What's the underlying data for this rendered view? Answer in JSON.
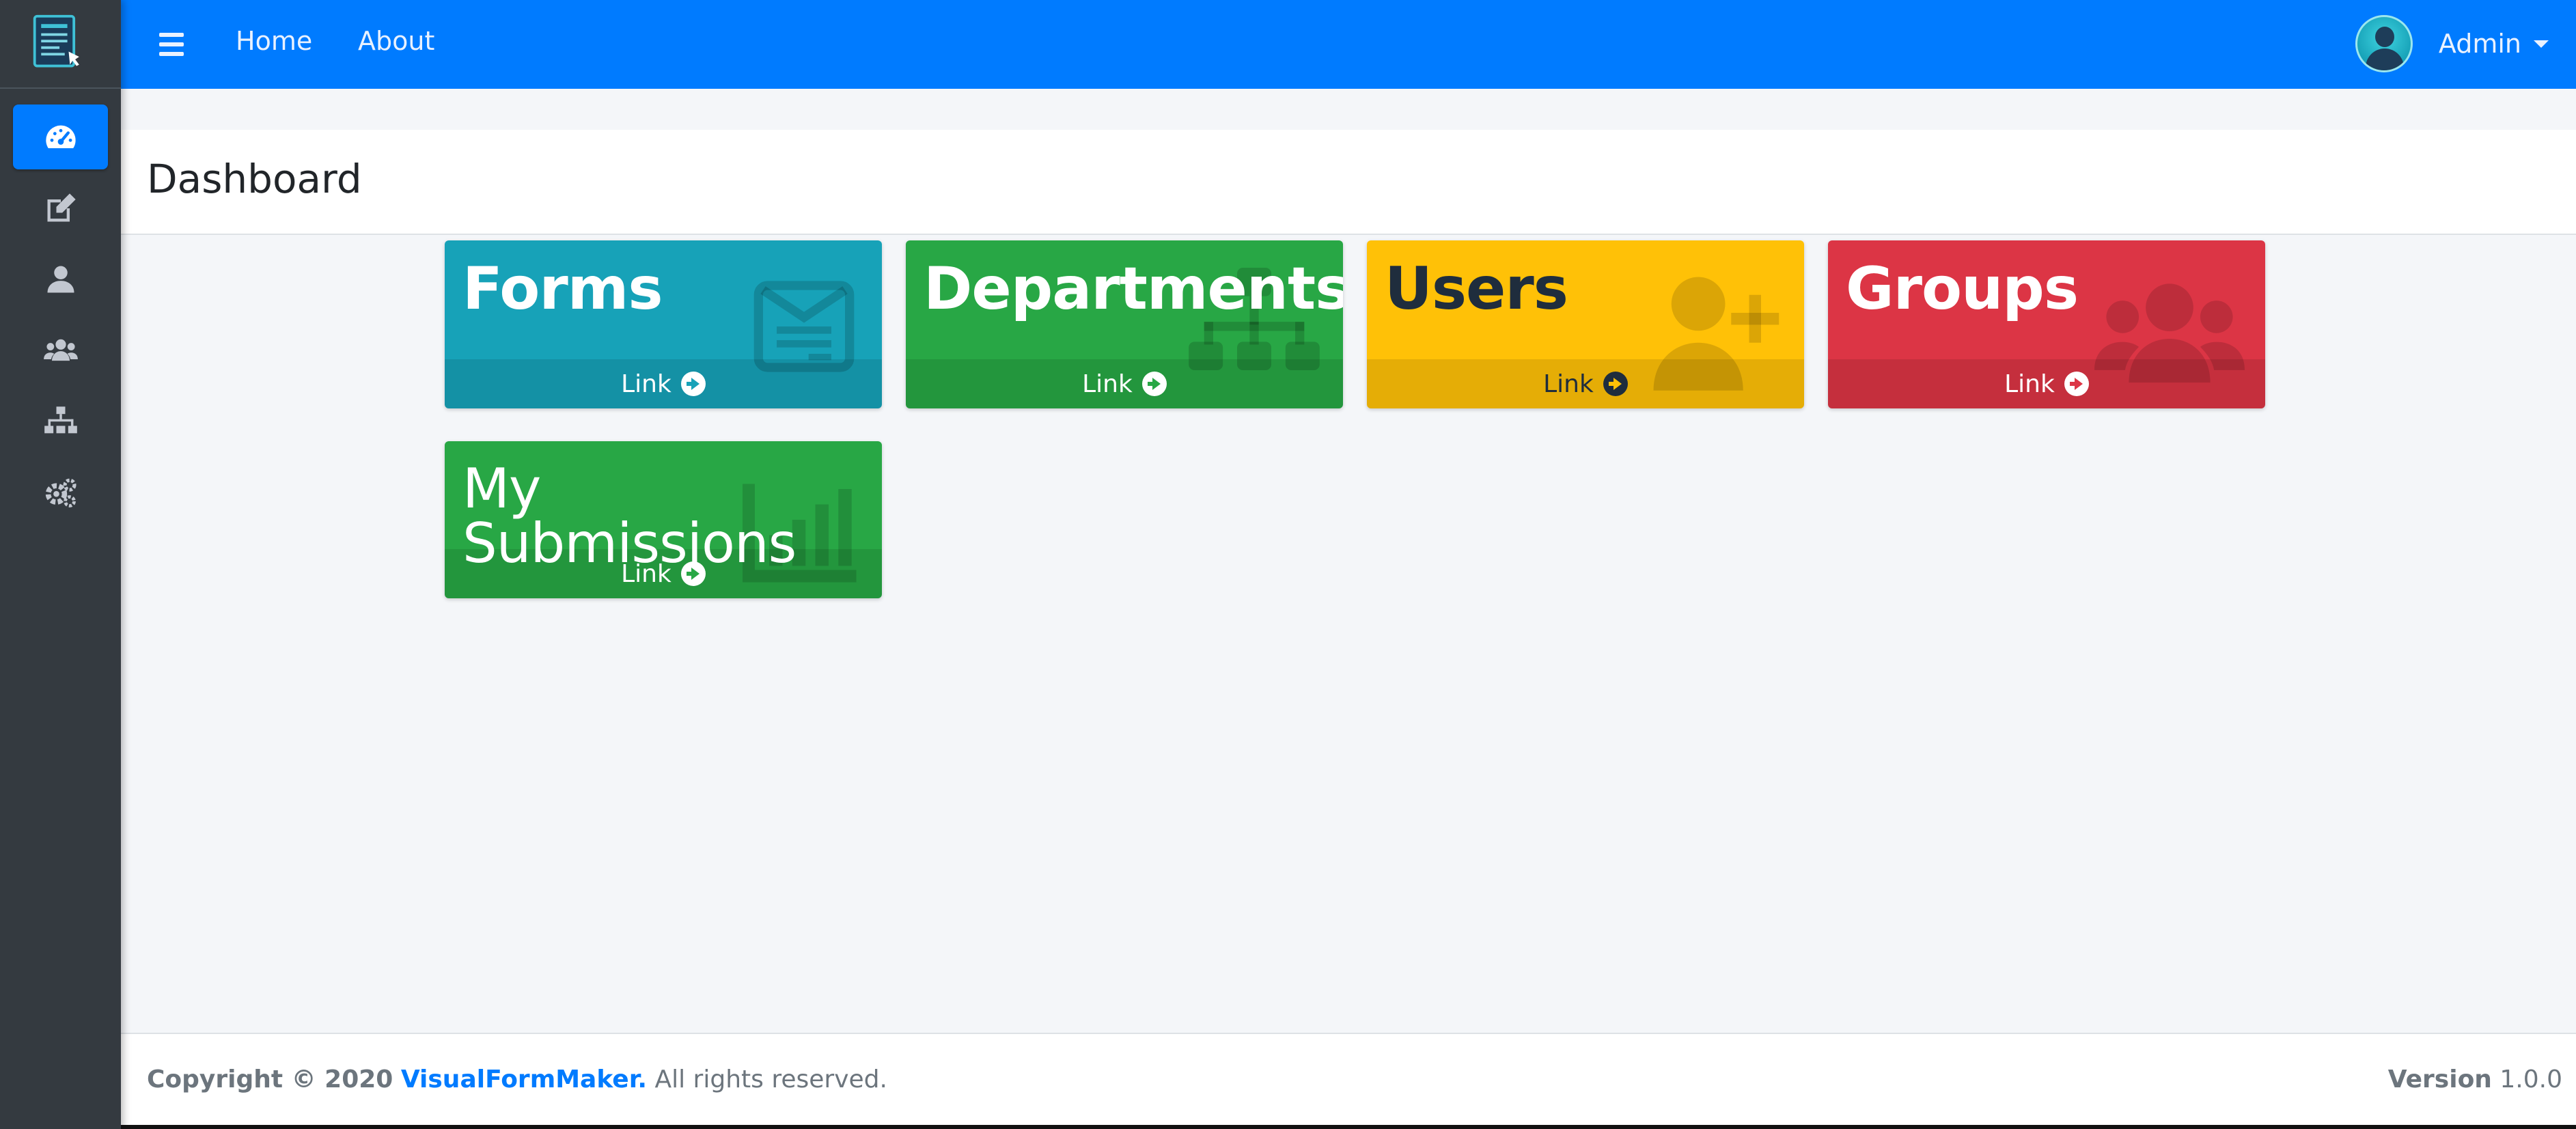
{
  "navbar": {
    "menu_icon": "hamburger-icon",
    "links": [
      {
        "label": "Home"
      },
      {
        "label": "About"
      }
    ],
    "user": {
      "name": "Admin",
      "avatar_icon": "user-avatar-icon"
    }
  },
  "sidebar": {
    "logo_icon": "form-document-icon",
    "items": [
      {
        "icon": "tachometer-icon",
        "active": true
      },
      {
        "icon": "edit-icon",
        "active": false
      },
      {
        "icon": "user-icon",
        "active": false
      },
      {
        "icon": "users-icon",
        "active": false
      },
      {
        "icon": "sitemap-icon",
        "active": false
      },
      {
        "icon": "cogs-icon",
        "active": false
      }
    ]
  },
  "page": {
    "title": "Dashboard"
  },
  "tiles": [
    {
      "title": "Forms",
      "link_label": "Link",
      "icon": "newspaper-icon",
      "color": "#17a2b8"
    },
    {
      "title": "Departments",
      "link_label": "Link",
      "icon": "sitemap-icon",
      "color": "#28a745"
    },
    {
      "title": "Users",
      "link_label": "Link",
      "icon": "user-plus-icon",
      "color": "#ffc107"
    },
    {
      "title": "Groups",
      "link_label": "Link",
      "icon": "users-icon",
      "color": "#dc3545"
    },
    {
      "title": "My Submissions",
      "link_label": "Link",
      "icon": "chart-bar-icon",
      "color": "#28a745"
    }
  ],
  "footer": {
    "copyright_prefix": "Copyright © 2020",
    "brand": "VisualFormMaker.",
    "suffix": "All rights reserved.",
    "version_label": "Version",
    "version_value": "1.0.0"
  },
  "colors": {
    "primary": "#007bff",
    "sidebar": "#343a40",
    "info": "#17a2b8",
    "success": "#28a745",
    "warning": "#ffc107",
    "danger": "#dc3545"
  }
}
